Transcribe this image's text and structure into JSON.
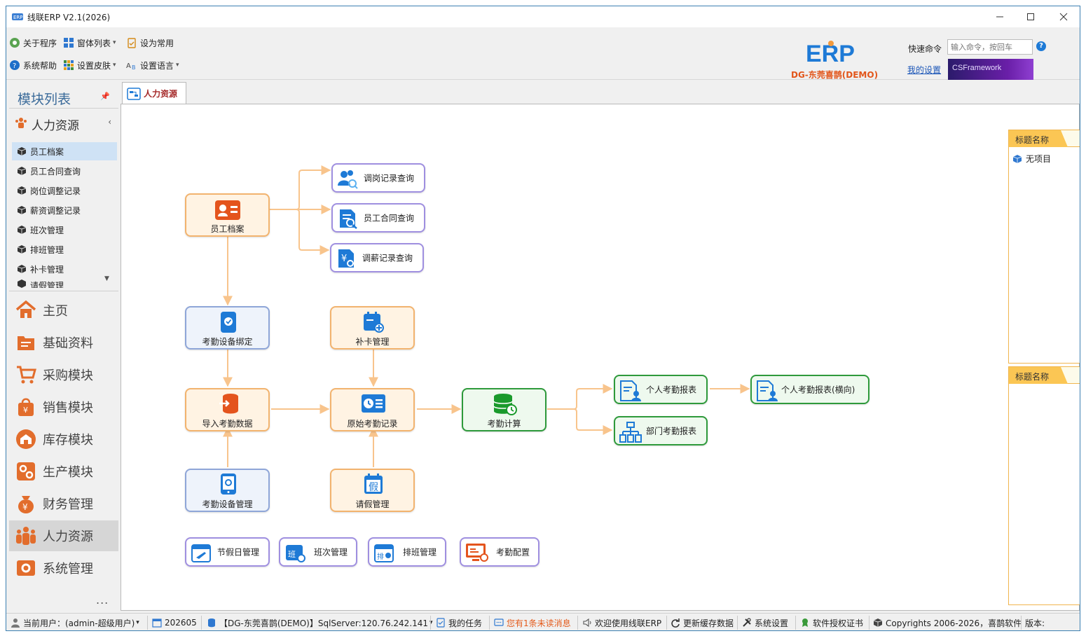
{
  "window": {
    "title": "线联ERP V2.1(2026)"
  },
  "toolbar": {
    "about": "关于程序",
    "window_list": "窗体列表",
    "set_common": "设为常用",
    "system_help": "系统帮助",
    "set_skin": "设置皮肤",
    "set_language": "设置语言"
  },
  "brand": {
    "logo_text": "ERP",
    "subtitle": "DG-东莞喜鹊(DEMO)",
    "banner": "CSFramework"
  },
  "quick_command": {
    "label": "快速命令",
    "placeholder": "输入命令，按回车",
    "my_settings": "我的设置"
  },
  "sidebar": {
    "title": "模块列表",
    "group": "人力资源",
    "items": [
      "员工档案",
      "员工合同查询",
      "岗位调整记录",
      "薪资调整记录",
      "班次管理",
      "排班管理",
      "补卡管理",
      "请假管理"
    ],
    "modules": [
      "主页",
      "基础资料",
      "采购模块",
      "销售模块",
      "库存模块",
      "生产模块",
      "财务管理",
      "人力资源",
      "系统管理"
    ],
    "more": "..."
  },
  "tab": {
    "label": "人力资源"
  },
  "flow": {
    "employee_file": "员工档案",
    "transfer_query": "调岗记录查询",
    "contract_query": "员工合同查询",
    "salary_query": "调薪记录查询",
    "device_bind": "考勤设备绑定",
    "card_fix": "补卡管理",
    "import_data": "导入考勤数据",
    "raw_records": "原始考勤记录",
    "calc": "考勤计算",
    "personal_report": "个人考勤报表",
    "personal_report_h": "个人考勤报表(横向)",
    "dept_report": "部门考勤报表",
    "device_mgmt": "考勤设备管理",
    "leave_mgmt": "请假管理",
    "holiday_mgmt": "节假日管理",
    "shift_mgmt": "班次管理",
    "schedule_mgmt": "排班管理",
    "att_config": "考勤配置"
  },
  "right_panels": [
    {
      "header": "标题名称",
      "items": [
        "无项目"
      ]
    },
    {
      "header": "标题名称",
      "items": []
    }
  ],
  "status": {
    "user": "当前用户：(admin-超级用户)",
    "period": "202605",
    "db": "【DG-东莞喜鹊(DEMO)】SqlServer:120.76.242.141",
    "tasks": "我的任务",
    "unread": "您有1条未读消息",
    "welcome": "欢迎使用线联ERP",
    "refresh": "更新缓存数据",
    "settings": "系统设置",
    "license": "软件授权证书",
    "copyright": "Copyrights 2006-2026，喜鹊软件",
    "version": "版本:"
  },
  "colors": {
    "accent_orange": "#f39a3d",
    "accent_blue": "#1e7ad6",
    "accent_green": "#2e9a3b",
    "title_red": "#a52a2a"
  }
}
